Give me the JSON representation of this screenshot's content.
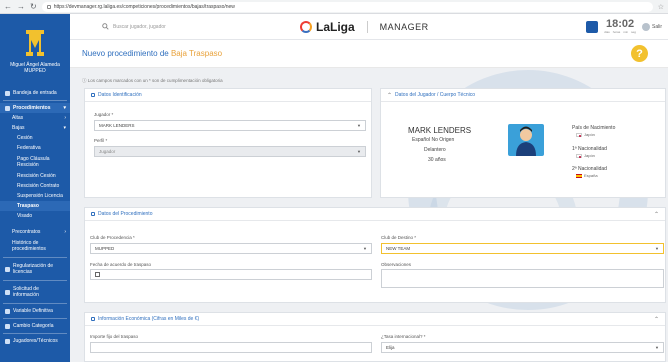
{
  "browser": {
    "url": "https://devmanager.rg.laliga.es/competiciones/procedimientos/bajas/traspaso/new"
  },
  "sidebar": {
    "user_name": "Miguel Ángel Alameda",
    "user_club": "MUPPED",
    "items": [
      {
        "label": "Bandeja de entrada",
        "level": "top"
      },
      {
        "label": "Procedimientos",
        "level": "top",
        "active": true
      },
      {
        "label": "Altas",
        "level": "lvl1"
      },
      {
        "label": "Bajas",
        "level": "lvl1"
      },
      {
        "label": "Cesión",
        "level": "lvl2"
      },
      {
        "label": "Federativa",
        "level": "lvl2"
      },
      {
        "label": "Pago Cláusula Rescisión",
        "level": "lvl2",
        "multi": true
      },
      {
        "label": "Rescisión Cesión",
        "level": "lvl2"
      },
      {
        "label": "Rescisión Contrato",
        "level": "lvl2"
      },
      {
        "label": "Suspensión Licencia",
        "level": "lvl2"
      },
      {
        "label": "Traspaso",
        "level": "lvl2"
      },
      {
        "label": "Visado",
        "level": "lvl2"
      },
      {
        "label": "Precontratos",
        "level": "lvl1"
      },
      {
        "label": "Histórico de procedimientos",
        "level": "lvl1",
        "multi": true
      },
      {
        "label": "Regularización de licencias",
        "level": "top",
        "multi": true
      },
      {
        "label": "Solicitud de información",
        "level": "top",
        "multi": true
      },
      {
        "label": "Variable Definitiva",
        "level": "top"
      },
      {
        "label": "Cambio Categoría",
        "level": "top"
      },
      {
        "label": "Jugadores/Técnicos",
        "level": "top"
      }
    ]
  },
  "header": {
    "search_placeholder": "Buscar jugador, jugador",
    "brand": "LaLiga",
    "product": "MANAGER",
    "clock_time": "18:02",
    "clock_labels": [
      "días",
      "horas",
      "min",
      "seg"
    ],
    "user_label": "Salir"
  },
  "page": {
    "title_prefix": "Nuevo procedimiento de",
    "title_highlight": "Baja Traspaso",
    "help_label": "?",
    "note": "Los campos marcados con un * son de cumplimentación obligatoria"
  },
  "identificacion": {
    "title": "Datos Identificación",
    "jugador_label": "Jugador *",
    "jugador_value": "MARK LENDERS",
    "perfil_label": "Perfil *",
    "perfil_value": "Jugador"
  },
  "jugador_panel": {
    "title": "Datos del Jugador / Cuerpo Técnico",
    "name": "MARK LENDERS",
    "origin": "Español No Origen",
    "position": "Delantero",
    "age": "30 años",
    "pais_label": "País de Nacimiento",
    "pais_value": "Japón",
    "nac1_label": "1ª Nacionalidad",
    "nac1_value": "Japón",
    "nac2_label": "2ª Nacionalidad",
    "nac2_value": "España"
  },
  "procedimiento": {
    "title": "Datos del Procedimiento",
    "club_proc_label": "Club de Procedencia *",
    "club_proc_value": "MUPPED",
    "club_dest_label": "Club de Destino *",
    "club_dest_value": "NEW TEAM",
    "fecha_label": "Fecha de acuerdo de traspaso",
    "fecha_value": "",
    "obs_label": "Observaciones",
    "obs_value": ""
  },
  "economica": {
    "title": "Información Económica (Cifras en Miles de €)",
    "importe_label": "Importe fijo del traspaso",
    "importe_value": "",
    "tasa_label": "¿Tasa internacional? *",
    "tasa_value": "Elija"
  }
}
